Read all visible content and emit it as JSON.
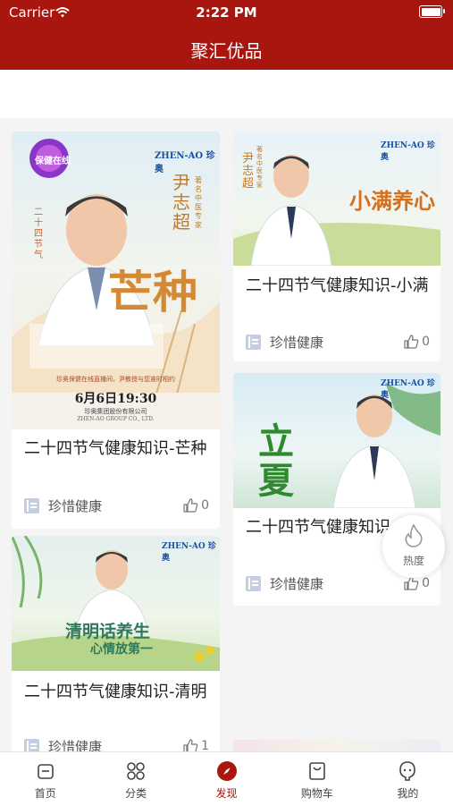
{
  "status_bar": {
    "carrier": "Carrier",
    "time": "2:22 PM"
  },
  "nav": {
    "title": "聚汇优品"
  },
  "cards": [
    {
      "title": "二十四节气健康知识-芒种",
      "author": "珍惜健康",
      "likes": "0",
      "image": {
        "brand": "ZHEN-AO",
        "brand_cn": "珍奥",
        "badge": "保健在线",
        "doctor": "尹志超",
        "doctor_title": "著名中医专家",
        "season_tag": "二十四节气",
        "banner": "芒种",
        "slogan": "珍奥保健在线直播间，尹教授与您准时相约",
        "datetime": "6月6日19:30",
        "company": "珍奥集团股份有限公司",
        "company_en": "ZHEN-AO GROUP CO., LTD."
      }
    },
    {
      "title": "二十四节气健康知识-小满",
      "author": "珍惜健康",
      "likes": "0",
      "image": {
        "brand": "ZHEN-AO",
        "brand_cn": "珍奥",
        "doctor": "尹志超",
        "doctor_title": "著名中医专家",
        "banner": "小满养心"
      }
    },
    {
      "title": "二十四节气健康知识-立夏",
      "author": "珍惜健康",
      "likes": "0",
      "image": {
        "brand": "ZHEN-AO",
        "brand_cn": "珍奥",
        "banner": "立夏"
      }
    },
    {
      "title": "二十四节气健康知识-清明",
      "author": "珍惜健康",
      "likes": "1",
      "image": {
        "brand": "ZHEN-AO",
        "brand_cn": "珍奥",
        "banner": "清明话养生",
        "subtitle": "心情放第一"
      }
    }
  ],
  "floating": {
    "label": "热度"
  },
  "tabbar": [
    {
      "label": "首页",
      "icon": "home-icon"
    },
    {
      "label": "分类",
      "icon": "category-icon"
    },
    {
      "label": "发现",
      "icon": "compass-icon",
      "active": true
    },
    {
      "label": "购物车",
      "icon": "cart-icon"
    },
    {
      "label": "我的",
      "icon": "profile-icon"
    }
  ],
  "colors": {
    "brand_red": "#a9150f",
    "active_tab": "#a9150f",
    "background": "#f4f4f4"
  }
}
